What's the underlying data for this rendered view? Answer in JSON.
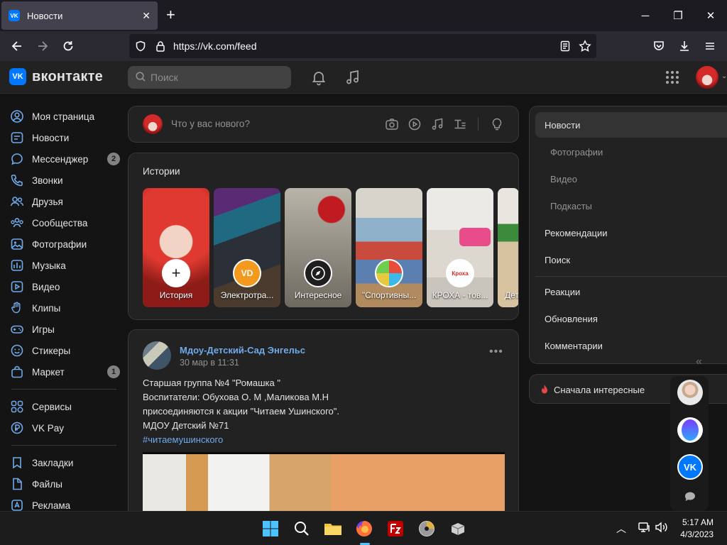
{
  "browser": {
    "tab_title": "Новости",
    "tab_favicon": "VK",
    "url": "https://vk.com/feed"
  },
  "header": {
    "logo_mark": "VK",
    "logo_text": "вконтакте",
    "search_placeholder": "Поиск"
  },
  "sidebar": {
    "items": [
      {
        "label": "Моя страница",
        "icon": "user-circle-icon",
        "badge": ""
      },
      {
        "label": "Новости",
        "icon": "news-icon",
        "badge": ""
      },
      {
        "label": "Мессенджер",
        "icon": "chat-icon",
        "badge": "2"
      },
      {
        "label": "Звонки",
        "icon": "phone-icon",
        "badge": ""
      },
      {
        "label": "Друзья",
        "icon": "friends-icon",
        "badge": ""
      },
      {
        "label": "Сообщества",
        "icon": "communities-icon",
        "badge": ""
      },
      {
        "label": "Фотографии",
        "icon": "photo-icon",
        "badge": ""
      },
      {
        "label": "Музыка",
        "icon": "music-icon",
        "badge": ""
      },
      {
        "label": "Видео",
        "icon": "video-icon",
        "badge": ""
      },
      {
        "label": "Клипы",
        "icon": "clips-icon",
        "badge": ""
      },
      {
        "label": "Игры",
        "icon": "gamepad-icon",
        "badge": ""
      },
      {
        "label": "Стикеры",
        "icon": "sticker-icon",
        "badge": ""
      },
      {
        "label": "Маркет",
        "icon": "market-bag-icon",
        "badge": "1"
      },
      {
        "label": "Сервисы",
        "icon": "services-grid-icon",
        "badge": ""
      },
      {
        "label": "VK Pay",
        "icon": "vkpay-icon",
        "badge": ""
      },
      {
        "label": "Закладки",
        "icon": "bookmark-icon",
        "badge": ""
      },
      {
        "label": "Файлы",
        "icon": "file-icon",
        "badge": ""
      },
      {
        "label": "Реклама",
        "icon": "ads-icon",
        "badge": ""
      }
    ]
  },
  "composer": {
    "placeholder": "Что у вас нового?"
  },
  "stories": {
    "title": "Истории",
    "items": [
      {
        "label": "История",
        "badge": "+"
      },
      {
        "label": "Электротра...",
        "badge": "VD"
      },
      {
        "label": "Интересное",
        "badge": ""
      },
      {
        "label": "\"Спортивны...",
        "badge": ""
      },
      {
        "label": "КРОХА - тов...",
        "badge": "Кроха"
      },
      {
        "label": "Дет...",
        "badge": ""
      }
    ]
  },
  "post": {
    "author": "Мдоу-Детский-Сад Энгельс",
    "date": "30 мар в 11:31",
    "lines": [
      "Старшая группа №4 \"Ромашка \"",
      "Воспитатели: Обухова О. М ,Маликова М.Н",
      "присоединяются к акции \"Читаем Ушинского\".",
      "МДОУ Детский №71"
    ],
    "hashtag": "#читаемушинского",
    "more": "•••"
  },
  "right_menu": {
    "active": "Новости",
    "subitems": [
      "Фотографии",
      "Видео",
      "Подкасты"
    ],
    "items": [
      "Рекомендации",
      "Поиск"
    ],
    "items2": [
      "Реакции",
      "Обновления",
      "Комментарии"
    ],
    "filter": "Сначала интересные",
    "collapse": "«"
  },
  "taskbar": {
    "time": "5:17 AM",
    "date": "4/3/2023"
  },
  "colors": {
    "accent": "#0077ff",
    "link": "#71aaeb",
    "background": "#141414",
    "card": "#222222"
  }
}
